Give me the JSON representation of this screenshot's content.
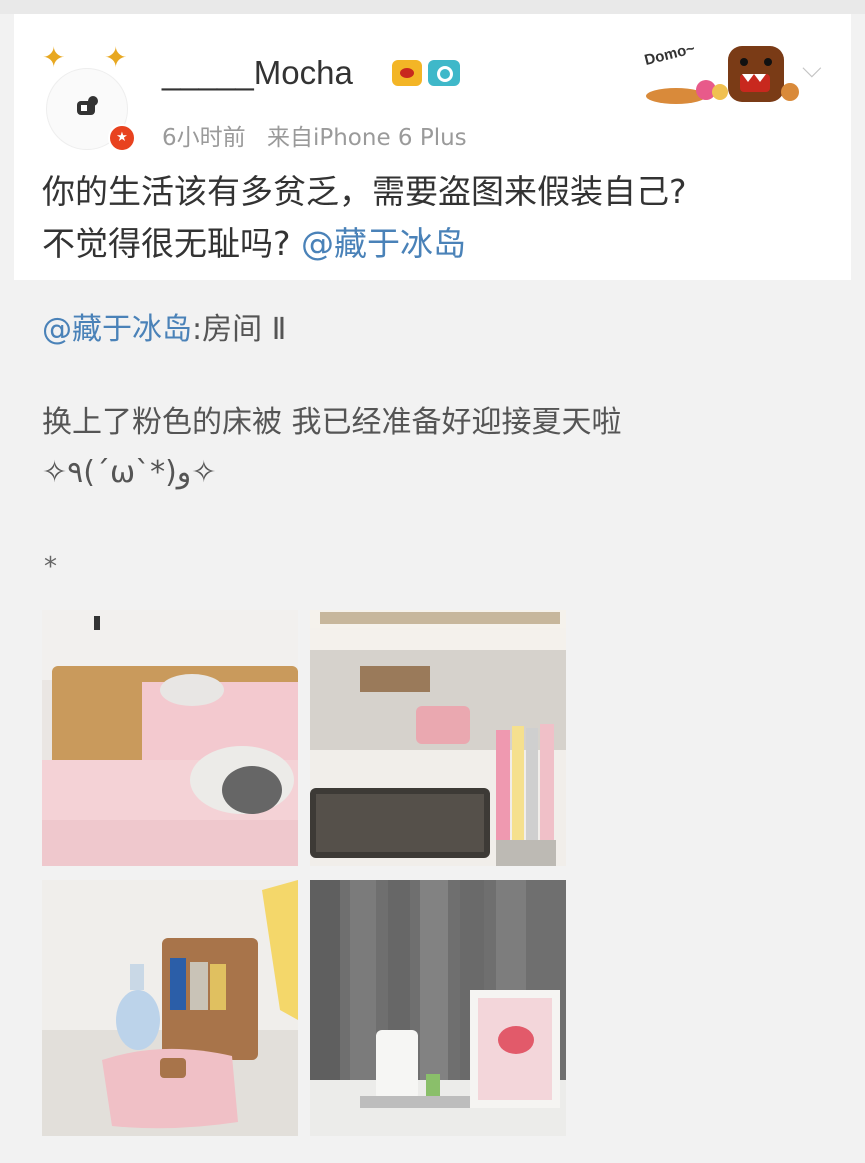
{
  "post": {
    "username": "_____Mocha",
    "time": "6小时前",
    "source": "来自iPhone 6 Plus",
    "text_line1": "你的生活该有多贫乏，需要盗图来假装自己?",
    "text_line2": "不觉得很无耻吗?",
    "mention": "@藏于冰岛",
    "sticker_text": "Domo~",
    "icons": [
      "antler-icon",
      "vip-crown-icon",
      "camera-icon",
      "verified-badge-icon",
      "chevron-down-icon"
    ]
  },
  "repost": {
    "author": "@藏于冰岛",
    "title_suffix": ":房间 Ⅱ",
    "line1": "换上了粉色的床被 我已经准备好迎接夏天啦",
    "line2": "✧٩(ˊωˋ*)و✧",
    "line3": "*",
    "images": [
      "pink-bed-photo",
      "shelf-speaker-photo",
      "cosmetics-bag-photo",
      "curtain-frame-photo"
    ]
  },
  "colors": {
    "link": "#4a82b8",
    "text": "#333333",
    "meta": "#9a9a9a",
    "background": "#f2f2f2"
  }
}
